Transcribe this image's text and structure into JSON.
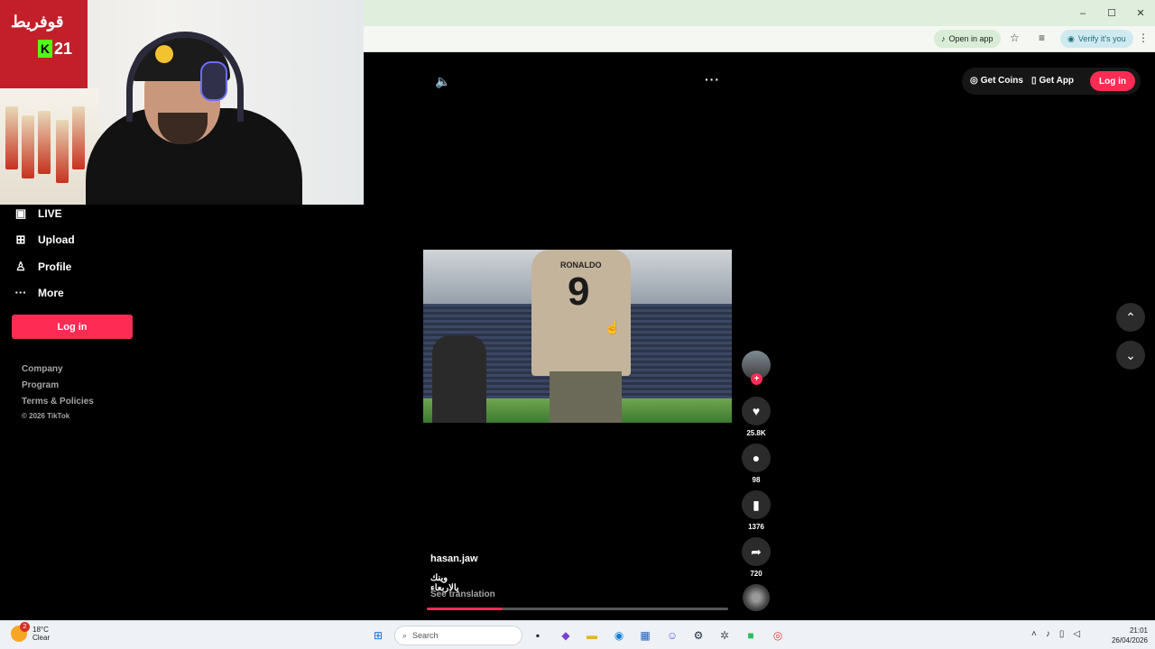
{
  "browser": {
    "open_in_app": "Open in app",
    "verify": "Verify it's you",
    "window_controls": [
      "–",
      "☐",
      "✕"
    ]
  },
  "stream_overlay": {
    "banner_text": "قوفريط",
    "viewer_count": "21"
  },
  "sidebar": {
    "items": [
      {
        "label": "LIVE",
        "icon": "live-tv-icon",
        "glyph": "📺"
      },
      {
        "label": "Upload",
        "icon": "upload-icon",
        "glyph": "⊞"
      },
      {
        "label": "Profile",
        "icon": "profile-icon",
        "glyph": "👤"
      },
      {
        "label": "More",
        "icon": "more-icon",
        "glyph": "···"
      }
    ],
    "login_label": "Log in",
    "footer": [
      "Company",
      "Program",
      "Terms & Policies"
    ],
    "copyright": "© 2026 TikTok"
  },
  "header": {
    "get_coins": "Get Coins",
    "get_app": "Get App",
    "login_label": "Log in"
  },
  "video": {
    "jersey_name": "RONALDO",
    "jersey_number": "9",
    "progress": 0.25
  },
  "actions": {
    "likes": "25.8K",
    "comments": "98",
    "saves": "1376",
    "shares": "720"
  },
  "post": {
    "author": "hasan.jaw",
    "caption": "وينك يالاربعاء",
    "see_translation": "See translation"
  },
  "taskbar": {
    "temperature": "18°C",
    "condition": "Clear",
    "notification_count": "2",
    "search_placeholder": "Search",
    "time": "21:01",
    "date": "26/04/2026"
  },
  "colors": {
    "accent": "#fe2c55",
    "background": "#000000"
  }
}
